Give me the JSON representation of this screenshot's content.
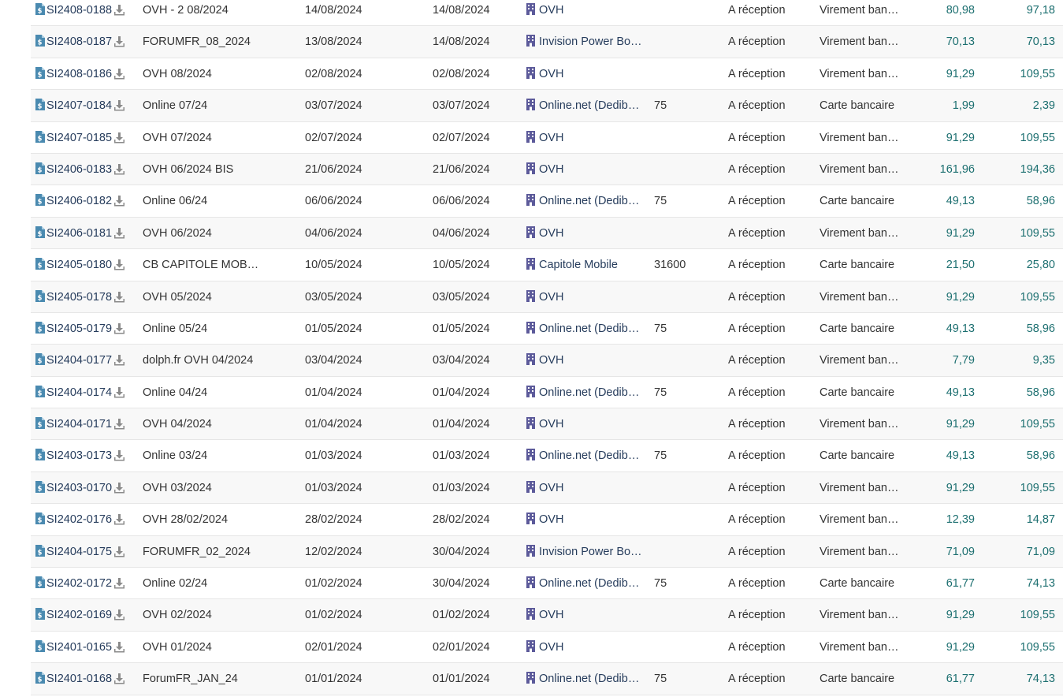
{
  "rows": [
    {
      "ref": "SI2408-0188",
      "label": "OVH - 2 08/2024",
      "date": "14/08/2024",
      "due": "14/08/2024",
      "supplier": "OVH",
      "zip": "",
      "status": "A réception",
      "payment": "Virement ban…",
      "ht": "80,98",
      "ttc": "97,18"
    },
    {
      "ref": "SI2408-0187",
      "label": "FORUMFR_08_2024",
      "date": "13/08/2024",
      "due": "14/08/2024",
      "supplier": "Invision Power Bo…",
      "zip": "",
      "status": "A réception",
      "payment": "Virement ban…",
      "ht": "70,13",
      "ttc": "70,13"
    },
    {
      "ref": "SI2408-0186",
      "label": "OVH 08/2024",
      "date": "02/08/2024",
      "due": "02/08/2024",
      "supplier": "OVH",
      "zip": "",
      "status": "A réception",
      "payment": "Virement ban…",
      "ht": "91,29",
      "ttc": "109,55"
    },
    {
      "ref": "SI2407-0184",
      "label": "Online 07/24",
      "date": "03/07/2024",
      "due": "03/07/2024",
      "supplier": "Online.net (Dedib…",
      "zip": "75",
      "status": "A réception",
      "payment": "Carte bancaire",
      "ht": "1,99",
      "ttc": "2,39"
    },
    {
      "ref": "SI2407-0185",
      "label": "OVH 07/2024",
      "date": "02/07/2024",
      "due": "02/07/2024",
      "supplier": "OVH",
      "zip": "",
      "status": "A réception",
      "payment": "Virement ban…",
      "ht": "91,29",
      "ttc": "109,55"
    },
    {
      "ref": "SI2406-0183",
      "label": "OVH 06/2024 BIS",
      "date": "21/06/2024",
      "due": "21/06/2024",
      "supplier": "OVH",
      "zip": "",
      "status": "A réception",
      "payment": "Virement ban…",
      "ht": "161,96",
      "ttc": "194,36"
    },
    {
      "ref": "SI2406-0182",
      "label": "Online 06/24",
      "date": "06/06/2024",
      "due": "06/06/2024",
      "supplier": "Online.net (Dedib…",
      "zip": "75",
      "status": "A réception",
      "payment": "Carte bancaire",
      "ht": "49,13",
      "ttc": "58,96"
    },
    {
      "ref": "SI2406-0181",
      "label": "OVH 06/2024",
      "date": "04/06/2024",
      "due": "04/06/2024",
      "supplier": "OVH",
      "zip": "",
      "status": "A réception",
      "payment": "Virement ban…",
      "ht": "91,29",
      "ttc": "109,55"
    },
    {
      "ref": "SI2405-0180",
      "label": "CB CAPITOLE MOB…",
      "date": "10/05/2024",
      "due": "10/05/2024",
      "supplier": "Capitole Mobile",
      "zip": "31600",
      "status": "A réception",
      "payment": "Carte bancaire",
      "ht": "21,50",
      "ttc": "25,80"
    },
    {
      "ref": "SI2405-0178",
      "label": "OVH 05/2024",
      "date": "03/05/2024",
      "due": "03/05/2024",
      "supplier": "OVH",
      "zip": "",
      "status": "A réception",
      "payment": "Virement ban…",
      "ht": "91,29",
      "ttc": "109,55"
    },
    {
      "ref": "SI2405-0179",
      "label": "Online 05/24",
      "date": "01/05/2024",
      "due": "01/05/2024",
      "supplier": "Online.net (Dedib…",
      "zip": "75",
      "status": "A réception",
      "payment": "Carte bancaire",
      "ht": "49,13",
      "ttc": "58,96"
    },
    {
      "ref": "SI2404-0177",
      "label": "dolph.fr OVH 04/2024",
      "date": "03/04/2024",
      "due": "03/04/2024",
      "supplier": "OVH",
      "zip": "",
      "status": "A réception",
      "payment": "Virement ban…",
      "ht": "7,79",
      "ttc": "9,35"
    },
    {
      "ref": "SI2404-0174",
      "label": "Online 04/24",
      "date": "01/04/2024",
      "due": "01/04/2024",
      "supplier": "Online.net (Dedib…",
      "zip": "75",
      "status": "A réception",
      "payment": "Carte bancaire",
      "ht": "49,13",
      "ttc": "58,96"
    },
    {
      "ref": "SI2404-0171",
      "label": "OVH 04/2024",
      "date": "01/04/2024",
      "due": "01/04/2024",
      "supplier": "OVH",
      "zip": "",
      "status": "A réception",
      "payment": "Virement ban…",
      "ht": "91,29",
      "ttc": "109,55"
    },
    {
      "ref": "SI2403-0173",
      "label": "Online 03/24",
      "date": "01/03/2024",
      "due": "01/03/2024",
      "supplier": "Online.net (Dedib…",
      "zip": "75",
      "status": "A réception",
      "payment": "Carte bancaire",
      "ht": "49,13",
      "ttc": "58,96"
    },
    {
      "ref": "SI2403-0170",
      "label": "OVH 03/2024",
      "date": "01/03/2024",
      "due": "01/03/2024",
      "supplier": "OVH",
      "zip": "",
      "status": "A réception",
      "payment": "Virement ban…",
      "ht": "91,29",
      "ttc": "109,55"
    },
    {
      "ref": "SI2402-0176",
      "label": "OVH 28/02/2024",
      "date": "28/02/2024",
      "due": "28/02/2024",
      "supplier": "OVH",
      "zip": "",
      "status": "A réception",
      "payment": "Virement ban…",
      "ht": "12,39",
      "ttc": "14,87"
    },
    {
      "ref": "SI2404-0175",
      "label": "FORUMFR_02_2024",
      "date": "12/02/2024",
      "due": "30/04/2024",
      "supplier": "Invision Power Bo…",
      "zip": "",
      "status": "A réception",
      "payment": "Virement ban…",
      "ht": "71,09",
      "ttc": "71,09"
    },
    {
      "ref": "SI2402-0172",
      "label": "Online 02/24",
      "date": "01/02/2024",
      "due": "30/04/2024",
      "supplier": "Online.net (Dedib…",
      "zip": "75",
      "status": "A réception",
      "payment": "Carte bancaire",
      "ht": "61,77",
      "ttc": "74,13"
    },
    {
      "ref": "SI2402-0169",
      "label": "OVH 02/2024",
      "date": "01/02/2024",
      "due": "01/02/2024",
      "supplier": "OVH",
      "zip": "",
      "status": "A réception",
      "payment": "Virement ban…",
      "ht": "91,29",
      "ttc": "109,55"
    },
    {
      "ref": "SI2401-0165",
      "label": "OVH 01/2024",
      "date": "02/01/2024",
      "due": "02/01/2024",
      "supplier": "OVH",
      "zip": "",
      "status": "A réception",
      "payment": "Virement ban…",
      "ht": "91,29",
      "ttc": "109,55"
    },
    {
      "ref": "SI2401-0168",
      "label": "ForumFR_JAN_24",
      "date": "01/01/2024",
      "due": "01/01/2024",
      "supplier": "Online.net (Dedib…",
      "zip": "75",
      "status": "A réception",
      "payment": "Carte bancaire",
      "ht": "61,77",
      "ttc": "74,13"
    }
  ],
  "colors": {
    "link": "#263c5c",
    "amount": "#1c6f70",
    "invoice_icon": "#4a8ab0",
    "download_icon": "#8a8a8a",
    "supplier_icon": "#5c5a9a",
    "row_odd": "#f8f8f8",
    "row_border": "#e6e6e6"
  },
  "icons": {
    "invoice": "invoice-document-icon",
    "download": "download-icon",
    "supplier": "building-icon"
  }
}
